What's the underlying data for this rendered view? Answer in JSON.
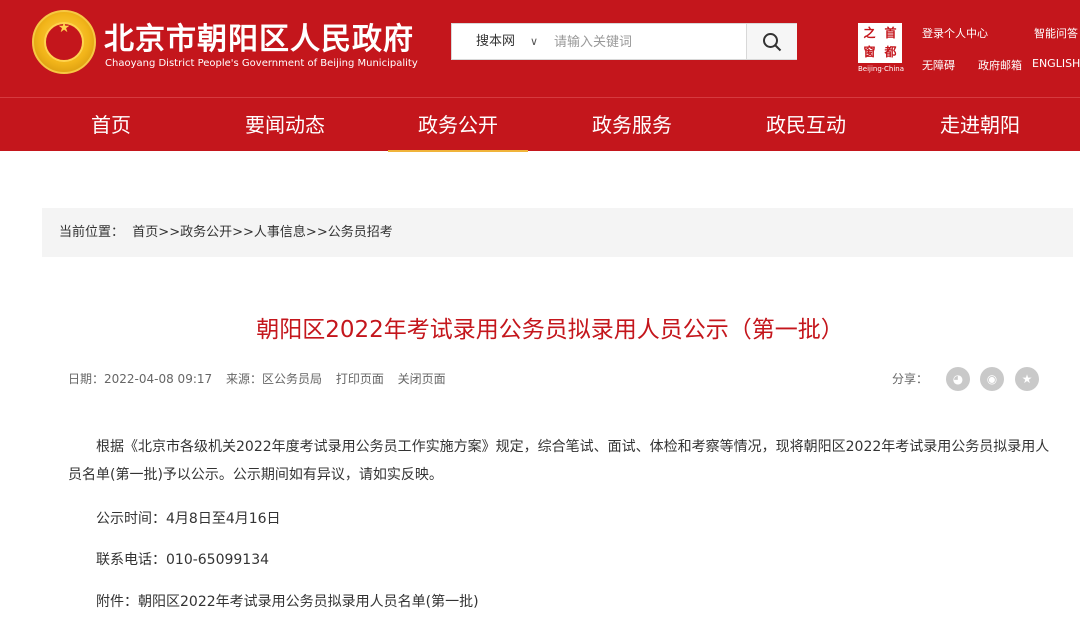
{
  "header": {
    "site_title": "北京市朝阳区人民政府",
    "site_subtitle": "Chaoyang District People's Government of Beijing Municipality",
    "search": {
      "scope_label": "搜本网",
      "placeholder": "请输入关键词"
    },
    "capital_logo": {
      "chars": [
        "之",
        "首",
        "窗",
        "都"
      ],
      "caption": "Beijing·China"
    },
    "top_links": {
      "login": "登录个人中心",
      "smart_qa": "智能问答",
      "accessibility": "无障碍",
      "gov_mail": "政府邮箱",
      "english": "ENGLISH"
    }
  },
  "nav": {
    "items": [
      "首页",
      "要闻动态",
      "政务公开",
      "政务服务",
      "政民互动",
      "走进朝阳"
    ],
    "active": "政务公开"
  },
  "breadcrumb": {
    "prefix": "当前位置：",
    "items": [
      "首页",
      "政务公开",
      "人事信息",
      "公务员招考"
    ],
    "separator": ">>"
  },
  "article": {
    "title": "朝阳区2022年考试录用公务员拟录用人员公示（第一批）",
    "date": "日期：2022-04-08 09:17",
    "source": "来源：区公务员局",
    "print": "打印页面",
    "close": "关闭页面",
    "share_label": "分享：",
    "share_icons": [
      "wechat-icon",
      "weibo-icon",
      "favorite-icon"
    ],
    "paragraph_1": "根据《北京市各级机关2022年度考试录用公务员工作实施方案》规定，综合笔试、面试、体检和考察等情况，现将朝阳区2022年考试录用公务员拟录用人员名单(第一批)予以公示。公示期间如有异议，请如实反映。",
    "period": "公示时间：4月8日至4月16日",
    "phone": "联系电话：010-65099134",
    "attachment": "附件：朝阳区2022年考试录用公务员拟录用人员名单(第一批)"
  },
  "colors": {
    "brand_red": "#c4161c",
    "active_underline": "#f0b43a",
    "breadcrumb_bg": "#f4f4f4"
  }
}
